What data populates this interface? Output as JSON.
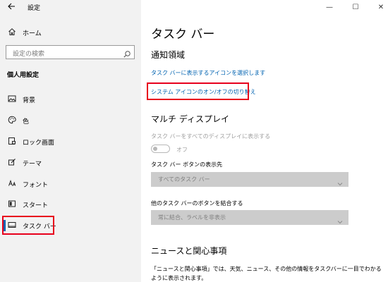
{
  "window": {
    "app_title": "設定",
    "minimize": "—",
    "maximize": "☐",
    "close": "✕"
  },
  "sidebar": {
    "home_label": "ホーム",
    "search_placeholder": "設定の検索",
    "section_header": "個人用設定",
    "items": [
      {
        "label": "背景",
        "icon": "picture-icon"
      },
      {
        "label": "色",
        "icon": "palette-icon"
      },
      {
        "label": "ロック画面",
        "icon": "lock-screen-icon"
      },
      {
        "label": "テーマ",
        "icon": "theme-brush-icon"
      },
      {
        "label": "フォント",
        "icon": "font-icon"
      },
      {
        "label": "スタート",
        "icon": "start-icon"
      },
      {
        "label": "タスク バー",
        "icon": "taskbar-icon",
        "selected": true
      }
    ]
  },
  "main": {
    "title": "タスク バー",
    "notification_area": {
      "heading": "通知領域",
      "link_select_icons": "タスク バーに表示するアイコンを選択します",
      "link_system_icons": "システム アイコンのオン/オフの切り替え"
    },
    "multi_display": {
      "heading": "マルチ ディスプレイ",
      "show_all_label": "タスク バーをすべてのディスプレイに表示する",
      "toggle_state": "オフ",
      "buttons_show_label": "タスク バー ボタンの表示先",
      "buttons_show_value": "すべてのタスク バー",
      "combine_label": "他のタスク バーのボタンを結合する",
      "combine_value": "常に結合、ラベルを非表示"
    },
    "news": {
      "heading": "ニュースと関心事項",
      "description": "「ニュースと関心事項」では、天気、ニュース、その他の情報をタスクバーに一目でわかるように表示されます。"
    }
  },
  "colors": {
    "accent": "#0063b1",
    "highlight_box": "#e8001c",
    "sidebar_bg": "#f2f2f2"
  }
}
